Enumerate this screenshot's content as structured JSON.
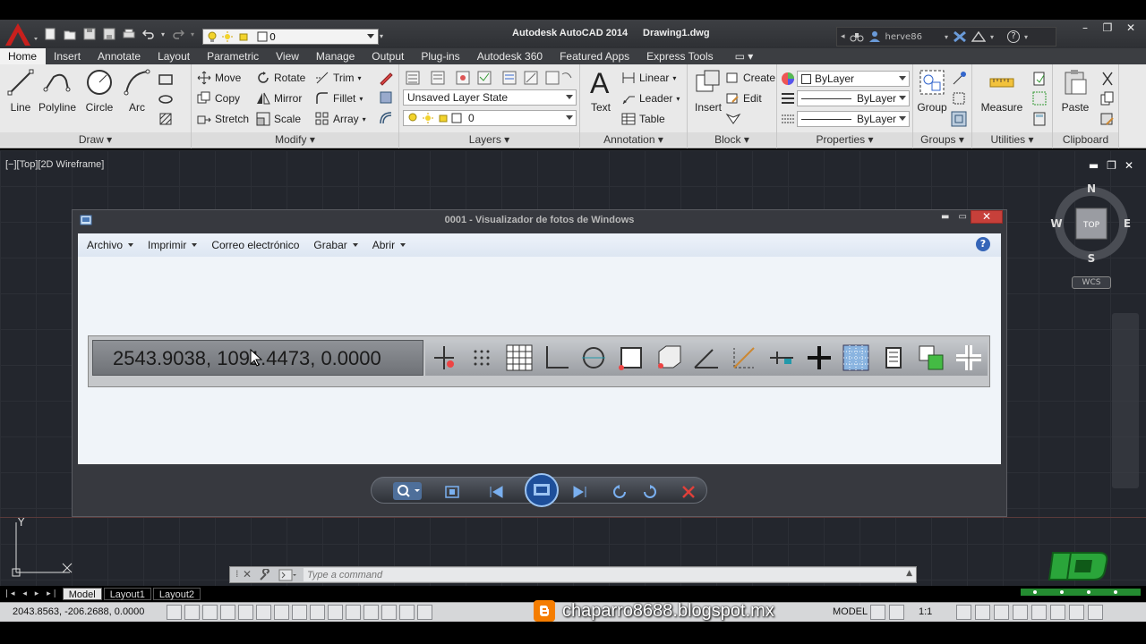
{
  "title_bar": {
    "app_title": "Autodesk AutoCAD 2014",
    "document_title": "Drawing1.dwg",
    "layer_value": "0",
    "user_name": "herve86"
  },
  "ribbon_tabs": [
    "Home",
    "Insert",
    "Annotate",
    "Layout",
    "Parametric",
    "View",
    "Manage",
    "Output",
    "Plug-ins",
    "Autodesk 360",
    "Featured Apps",
    "Express Tools"
  ],
  "ribbon": {
    "draw": {
      "label": "Draw",
      "line": "Line",
      "polyline": "Polyline",
      "circle": "Circle",
      "arc": "Arc"
    },
    "modify": {
      "label": "Modify",
      "move": "Move",
      "rotate": "Rotate",
      "trim": "Trim",
      "copy": "Copy",
      "mirror": "Mirror",
      "fillet": "Fillet",
      "stretch": "Stretch",
      "scale": "Scale",
      "array": "Array"
    },
    "layers": {
      "label": "Layers",
      "layer_state": "Unsaved Layer State",
      "layer_value": "0"
    },
    "annotation": {
      "label": "Annotation",
      "text": "Text",
      "linear": "Linear",
      "leader": "Leader",
      "table": "Table"
    },
    "block": {
      "label": "Block",
      "insert": "Insert",
      "create": "Create",
      "edit": "Edit"
    },
    "properties": {
      "label": "Properties",
      "color": "ByLayer",
      "lineweight": "ByLayer",
      "linetype": "ByLayer"
    },
    "groups": {
      "label": "Groups",
      "group": "Group"
    },
    "utilities": {
      "label": "Utilities",
      "measure": "Measure"
    },
    "clipboard": {
      "label": "Clipboard",
      "paste": "Paste"
    }
  },
  "viewport": {
    "label": "[−][Top][2D Wireframe]",
    "viewcube": {
      "n": "N",
      "s": "S",
      "e": "E",
      "w": "W",
      "top": "TOP"
    },
    "wcs": "WCS",
    "ucs_y": "Y"
  },
  "photo_viewer": {
    "title": "0001 - Visualizador de fotos de Windows",
    "menus": [
      "Archivo",
      "Imprimir",
      "Correo electrónico",
      "Grabar",
      "Abrir"
    ],
    "help": "?",
    "zoomed_coords": "2543.9038, 1091.4473, 0.0000"
  },
  "command_line": {
    "placeholder": "Type a command"
  },
  "layout_tabs": [
    "Model",
    "Layout1",
    "Layout2"
  ],
  "status_bar": {
    "coords": "2043.8563, -206.2688, 0.0000",
    "model": "MODEL",
    "scale": "1:1"
  },
  "watermark": "chaparro8688.blogspot.mx",
  "colors": {
    "autocad_red": "#c8201d",
    "ribbon_bg": "#e9e9e9",
    "canvas_bg": "#23262d",
    "viewer_close": "#c7403a"
  }
}
